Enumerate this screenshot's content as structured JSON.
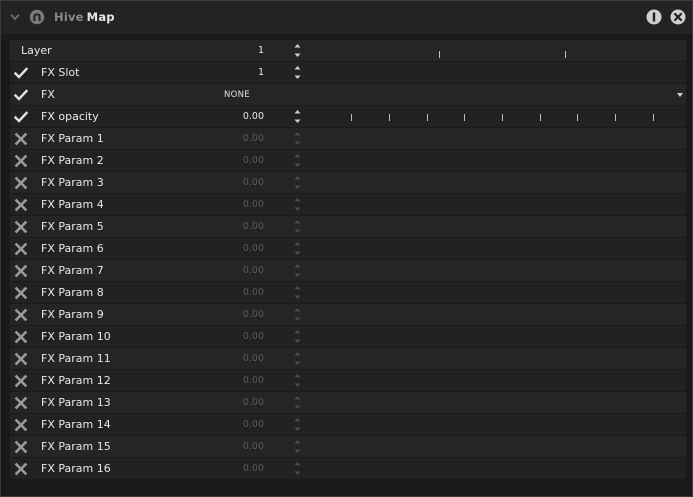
{
  "header": {
    "brand": "Hive",
    "title": "Map"
  },
  "rows": [
    {
      "label": "Layer",
      "value": "1",
      "type": "numeric",
      "status": "none",
      "ticks": [
        129,
        255
      ]
    },
    {
      "label": "FX Slot",
      "value": "1",
      "type": "numeric",
      "status": "enabled",
      "ticks": []
    },
    {
      "label": "FX",
      "value": "NONE",
      "type": "dropdown",
      "status": "enabled",
      "ticks": []
    },
    {
      "label": "FX opacity",
      "value": "0.00",
      "type": "numeric",
      "status": "enabled",
      "ticks": [
        41,
        79,
        117,
        154,
        192,
        230,
        267,
        305,
        343
      ]
    },
    {
      "label": "FX Param 1",
      "value": "0.00",
      "type": "numeric",
      "status": "disabled",
      "ticks": []
    },
    {
      "label": "FX Param 2",
      "value": "0.00",
      "type": "numeric",
      "status": "disabled",
      "ticks": []
    },
    {
      "label": "FX Param 3",
      "value": "0.00",
      "type": "numeric",
      "status": "disabled",
      "ticks": []
    },
    {
      "label": "FX Param 4",
      "value": "0.00",
      "type": "numeric",
      "status": "disabled",
      "ticks": []
    },
    {
      "label": "FX Param 5",
      "value": "0.00",
      "type": "numeric",
      "status": "disabled",
      "ticks": []
    },
    {
      "label": "FX Param 6",
      "value": "0.00",
      "type": "numeric",
      "status": "disabled",
      "ticks": []
    },
    {
      "label": "FX Param 7",
      "value": "0.00",
      "type": "numeric",
      "status": "disabled",
      "ticks": []
    },
    {
      "label": "FX Param 8",
      "value": "0.00",
      "type": "numeric",
      "status": "disabled",
      "ticks": []
    },
    {
      "label": "FX Param 9",
      "value": "0.00",
      "type": "numeric",
      "status": "disabled",
      "ticks": []
    },
    {
      "label": "FX Param 10",
      "value": "0.00",
      "type": "numeric",
      "status": "disabled",
      "ticks": []
    },
    {
      "label": "FX Param 11",
      "value": "0.00",
      "type": "numeric",
      "status": "disabled",
      "ticks": []
    },
    {
      "label": "FX Param 12",
      "value": "0.00",
      "type": "numeric",
      "status": "disabled",
      "ticks": []
    },
    {
      "label": "FX Param 13",
      "value": "0.00",
      "type": "numeric",
      "status": "disabled",
      "ticks": []
    },
    {
      "label": "FX Param 14",
      "value": "0.00",
      "type": "numeric",
      "status": "disabled",
      "ticks": []
    },
    {
      "label": "FX Param 15",
      "value": "0.00",
      "type": "numeric",
      "status": "disabled",
      "ticks": []
    },
    {
      "label": "FX Param 16",
      "value": "0.00",
      "type": "numeric",
      "status": "disabled",
      "ticks": []
    }
  ],
  "icons": {
    "collapse": "chevron-down-icon",
    "logo": "hive-logo-icon",
    "info": "info-icon",
    "close": "close-icon",
    "enabled": "check-icon",
    "disabled": "x-icon",
    "stepper": "stepper-icon",
    "dropdown": "triangle-down-icon"
  },
  "colors": {
    "background": "#1a1a1a",
    "row": "#252525",
    "text": "#e8e8e8",
    "muted_value": "#5a5a5a",
    "icon": "#dcdcdc"
  }
}
